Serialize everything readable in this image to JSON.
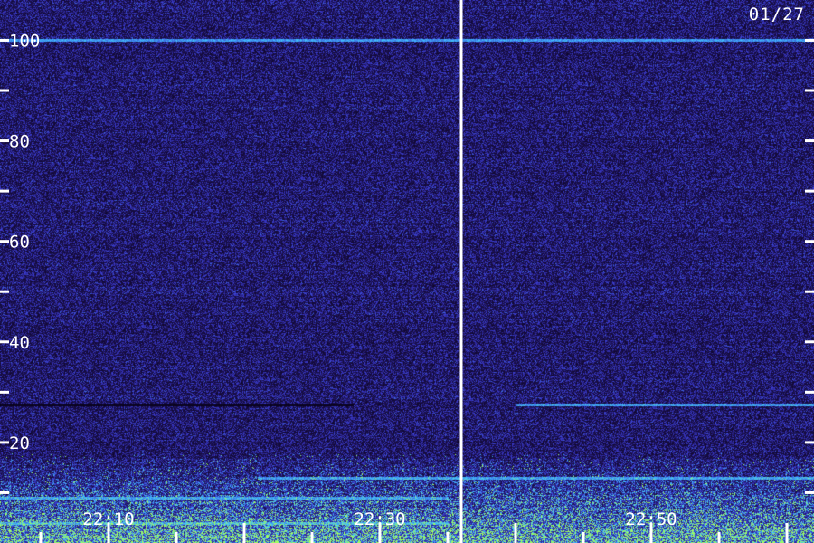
{
  "chart_data": {
    "type": "heatmap",
    "title": "",
    "xlabel": "",
    "ylabel": "",
    "date_label": "01/27",
    "y_ticks_labeled": [
      20,
      40,
      60,
      80,
      100
    ],
    "y_ticks_minor": [
      10,
      30,
      50,
      70,
      90
    ],
    "ylim": [
      0,
      108
    ],
    "x_time_labels": [
      "22:10",
      "22:30",
      "22:50"
    ],
    "x_minutes_range": [
      "22:02",
      "23:02"
    ],
    "x_minor_tick_interval_min": 5,
    "marker_time": "22:36",
    "bright_lines": [
      {
        "freq": 100,
        "from": "22:02",
        "to": "23:02",
        "intensity": 0.55
      },
      {
        "freq": 27.5,
        "from": "22:40",
        "to": "23:02",
        "intensity": 0.65
      },
      {
        "freq": 13,
        "from": "22:21",
        "to": "23:02",
        "intensity": 0.7
      },
      {
        "freq": 9,
        "from": "22:02",
        "to": "22:35",
        "intensity": 0.6
      },
      {
        "freq": 4,
        "from": "22:02",
        "to": "22:35",
        "intensity": 0.8
      }
    ],
    "dark_lines": [
      {
        "freq": 27.5,
        "from": "22:02",
        "to": "22:28"
      }
    ],
    "colors": {
      "background": "#2a1870",
      "low": "#1a0f4a",
      "mid": "#3b3bd0",
      "high": "#40c0ff",
      "peak": "#a0ff60",
      "label": "#ffffff"
    }
  }
}
